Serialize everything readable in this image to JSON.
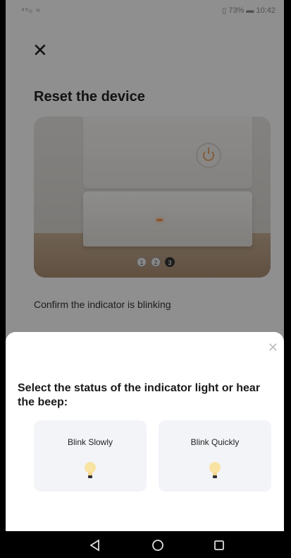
{
  "status_bar": {
    "signal": "⁴⁵ᵢₗ ≈",
    "right": "▯ 73% ▬ 10:42"
  },
  "page": {
    "title": "Reset the device",
    "carousel_pages": [
      "1",
      "2",
      "3"
    ],
    "carousel_active_index": 2,
    "confirm_text": "Confirm the indicator is blinking"
  },
  "sheet": {
    "title": "Select the status of the indicator light or hear the beep:",
    "options": [
      {
        "label": "Blink Slowly"
      },
      {
        "label": "Blink Quickly"
      }
    ]
  },
  "icons": {
    "close": "close-icon",
    "sheet_close": "close-icon",
    "bulb": "lightbulb-icon",
    "nav_back": "triangle-back-icon",
    "nav_home": "circle-home-icon",
    "nav_recents": "square-recents-icon"
  },
  "colors": {
    "bulb_glow": "#f9e3a3",
    "led": "#f28b3c"
  }
}
